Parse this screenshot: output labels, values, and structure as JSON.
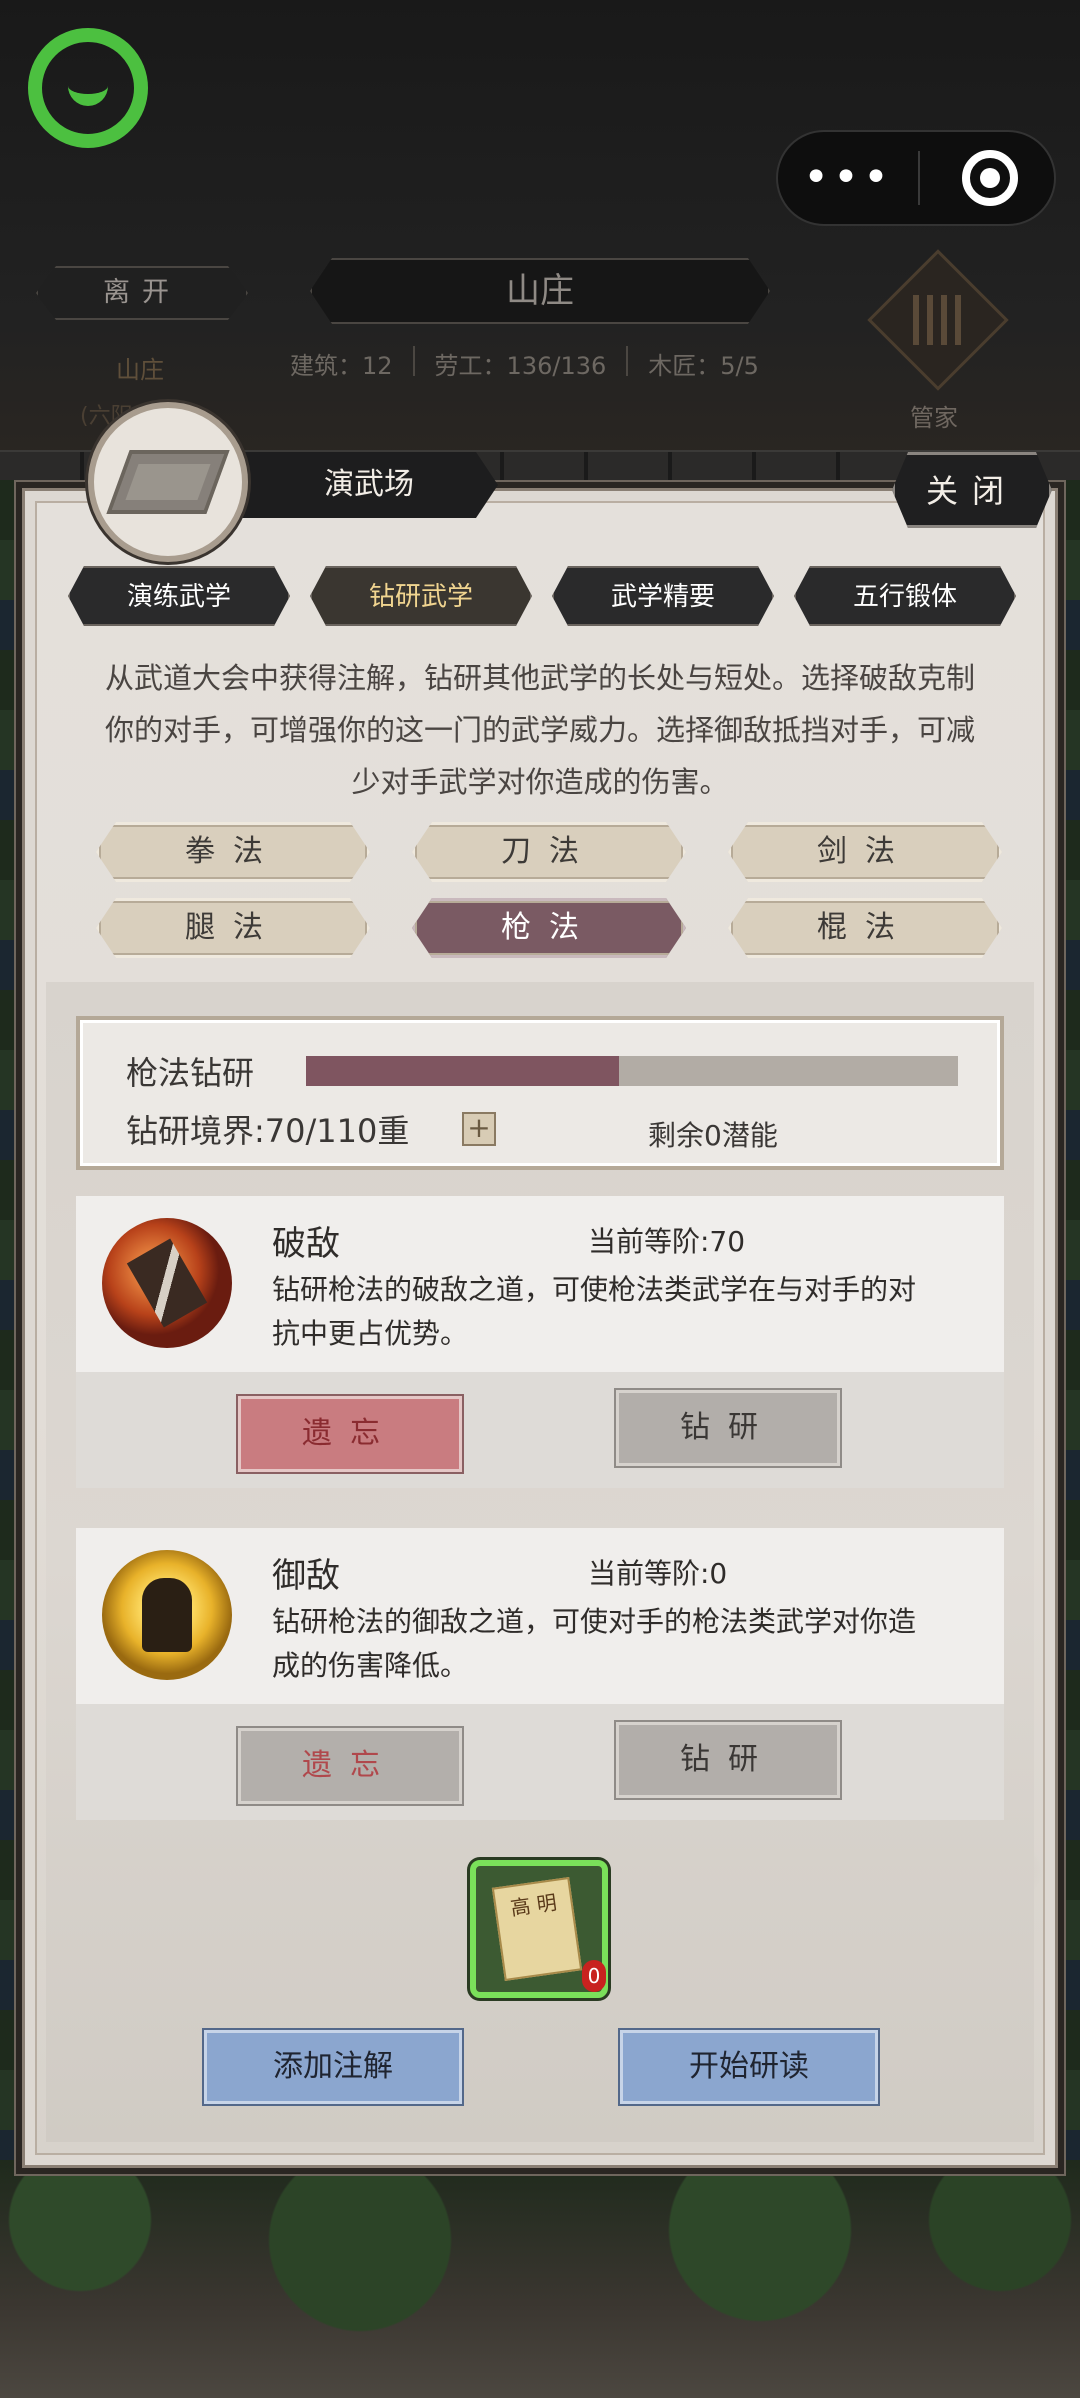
{
  "hud": {
    "leave_label": "离开",
    "title": "山庄",
    "loc_line1": "山庄",
    "loc_line2": "(六阳",
    "stats": {
      "buildings": "建筑：12",
      "labor": "劳工：136/136",
      "carpenter": "木匠：5/5"
    },
    "butler_label": "管家",
    "capsule_more_icon": "more-dots-icon",
    "capsule_close_icon": "target-icon"
  },
  "panel": {
    "title": "演武场",
    "close_label": "关闭",
    "tabs": [
      {
        "label": "演练武学",
        "active": false
      },
      {
        "label": "钻研武学",
        "active": true
      },
      {
        "label": "武学精要",
        "active": false
      },
      {
        "label": "五行锻体",
        "active": false
      }
    ],
    "description": "从武道大会中获得注解，钻研其他武学的长处与短处。选择破敌克制你的对手，可增强你的这一门的武学威力。选择御敌抵挡对手，可减少对手武学对你造成的伤害。",
    "categories": [
      {
        "label": "拳法",
        "active": false
      },
      {
        "label": "刀法",
        "active": false
      },
      {
        "label": "剑法",
        "active": false
      },
      {
        "label": "腿法",
        "active": false
      },
      {
        "label": "枪法",
        "active": true
      },
      {
        "label": "棍法",
        "active": false
      }
    ],
    "study": {
      "label": "枪法钻研",
      "progress_fraction": 0.48,
      "realm": "钻研境界:70/110重",
      "plus_label": "+",
      "remaining": "剩余0潜能"
    },
    "skills": [
      {
        "name": "破敌",
        "grade": "当前等阶:70",
        "text": "钻研枪法的破敌之道，可使枪法类武学在与对手的对抗中更占优势。",
        "forget_label": "遗忘",
        "study_label": "钻研"
      },
      {
        "name": "御敌",
        "grade": "当前等阶:0",
        "text": "钻研枪法的御敌之道，可使对手的枪法类武学对你造成的伤害降低。",
        "forget_label": "遗忘",
        "study_label": "钻研"
      }
    ],
    "item": {
      "paper_text": "高\n明",
      "count": "0"
    },
    "add_note_label": "添加注解",
    "start_read_label": "开始研读"
  },
  "colors": {
    "accent_active_category": "#7a5a63",
    "progress_fill": "#7f5560",
    "chat_logo_green": "#4cc040",
    "blue_button": "#8ba6cf"
  }
}
